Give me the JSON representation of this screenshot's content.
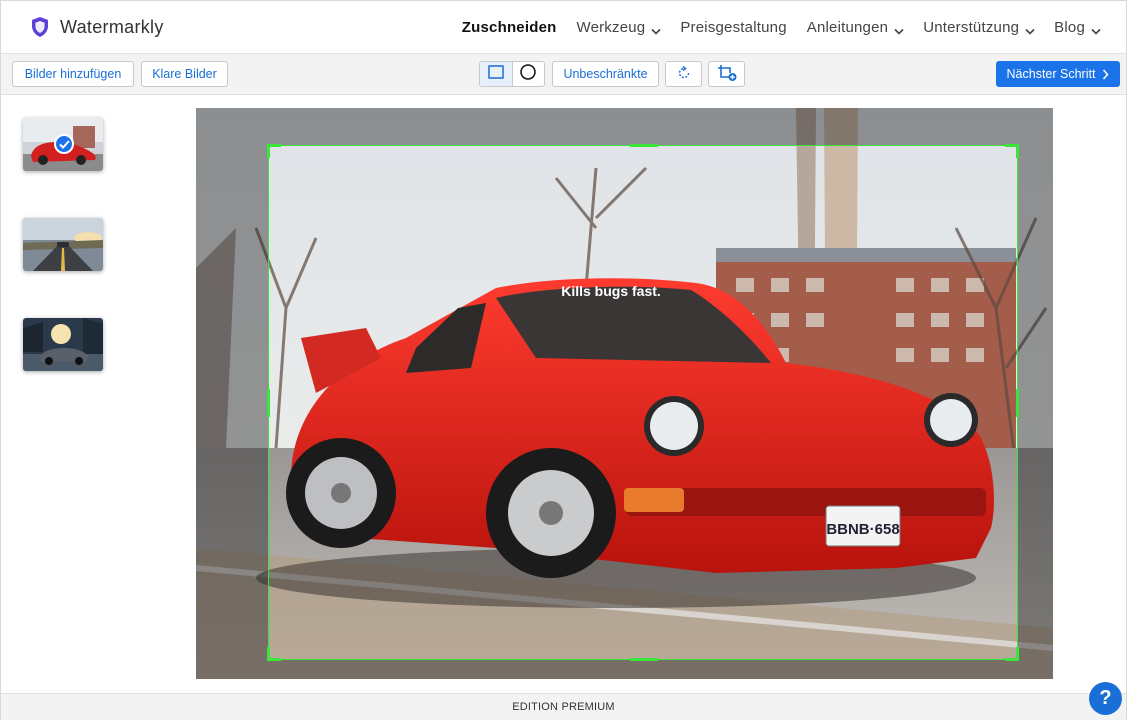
{
  "app": {
    "title": "Watermarkly",
    "brand_color": "#5b3fd6"
  },
  "nav": {
    "items": [
      {
        "label": "Zuschneiden",
        "active": true,
        "dropdown": false
      },
      {
        "label": "Werkzeug",
        "active": false,
        "dropdown": true
      },
      {
        "label": "Preisgestaltung",
        "active": false,
        "dropdown": false
      },
      {
        "label": "Anleitungen",
        "active": false,
        "dropdown": true
      },
      {
        "label": "Unterstützung",
        "active": false,
        "dropdown": true
      },
      {
        "label": "Blog",
        "active": false,
        "dropdown": true
      }
    ]
  },
  "toolbar": {
    "add_images": "Bilder hinzufügen",
    "clear_images": "Klare Bilder",
    "shape_rect_icon": "rectangle-icon",
    "shape_circle_icon": "circle-icon",
    "aspect_label": "Unbeschränkte",
    "rotate_icon": "rotate-icon",
    "add_crop_icon": "add-crop-icon",
    "next_step": "Nächster Schritt",
    "accent": "#1a73e8"
  },
  "thumbnails": [
    {
      "name": "red-porsche",
      "selected": true
    },
    {
      "name": "road-sunset",
      "selected": false
    },
    {
      "name": "car-sunset",
      "selected": false
    }
  ],
  "canvas": {
    "plate_text": "BBNB·658",
    "windshield_text": "Kills bugs fast.",
    "crop_color": "#39e639"
  },
  "footer": {
    "text": "EDITION PREMIUM"
  },
  "help": {
    "label": "?"
  }
}
